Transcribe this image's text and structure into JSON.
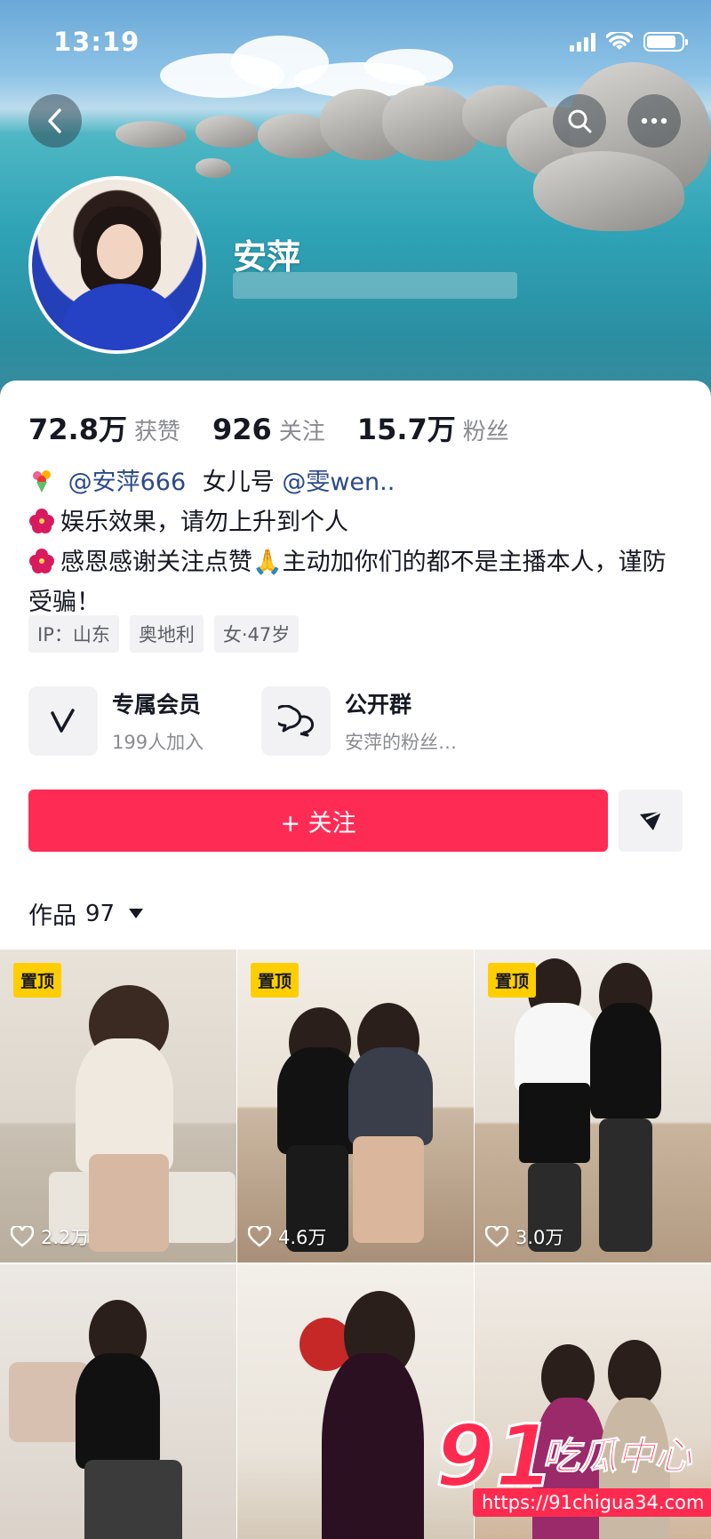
{
  "status_bar": {
    "time": "13:19"
  },
  "profile": {
    "nickname": "安萍"
  },
  "stats": [
    {
      "value": "72.8万",
      "label": "获赞"
    },
    {
      "value": "926",
      "label": "关注"
    },
    {
      "value": "15.7万",
      "label": "粉丝"
    }
  ],
  "bio": {
    "line1": {
      "mention1": "@安萍666",
      "text": "女儿号",
      "mention2": "@雯wen.."
    },
    "line2": "娱乐效果，请勿上升到个人",
    "line3": "感恩感谢关注点赞🙏主动加你们的都不是主播本人，谨防受骗！"
  },
  "tags": [
    "IP：山东",
    "奥地利",
    "女·47岁"
  ],
  "features": [
    {
      "title": "专属会员",
      "subtitle": "199人加入",
      "icon": "v-icon"
    },
    {
      "title": "公开群",
      "subtitle": "安萍的粉丝…",
      "icon": "chat-bubbles-icon"
    }
  ],
  "actions": {
    "follow_label": "+ 关注"
  },
  "works": {
    "label": "作品",
    "count": "97"
  },
  "videos": [
    {
      "pinned": "置顶",
      "likes": "2.2万"
    },
    {
      "pinned": "置顶",
      "likes": "4.6万"
    },
    {
      "pinned": "置顶",
      "likes": "3.0万"
    },
    {
      "likes": ""
    },
    {
      "likes": ""
    },
    {
      "likes": ""
    }
  ],
  "watermark": {
    "number": "91",
    "name": "吃瓜中心",
    "url": "https://91chigua34.com"
  },
  "colors": {
    "accent": "#fe2c55",
    "pin": "#fece00",
    "mention": "#2b4a8a"
  }
}
